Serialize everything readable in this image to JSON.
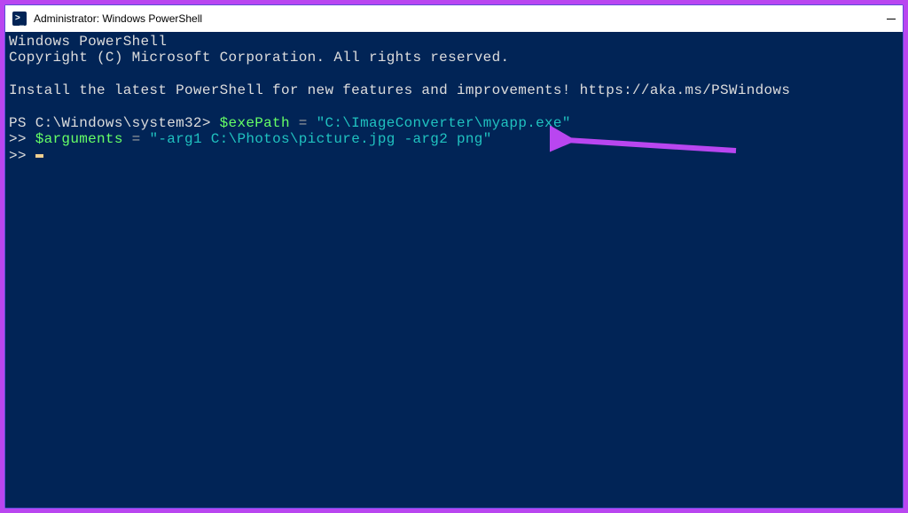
{
  "window": {
    "title": "Administrator: Windows PowerShell"
  },
  "terminal": {
    "header_line1": "Windows PowerShell",
    "header_line2": "Copyright (C) Microsoft Corporation. All rights reserved.",
    "install_line": "Install the latest PowerShell for new features and improvements! https://aka.ms/PSWindows",
    "prompt1_prefix": "PS C:\\Windows\\system32> ",
    "prompt1_var": "$exePath",
    "prompt1_op": " = ",
    "prompt1_str": "\"C:\\ImageConverter\\myapp.exe\"",
    "prompt2_prefix": ">> ",
    "prompt2_var": "$arguments",
    "prompt2_op": " = ",
    "prompt2_str": "\"-arg1 C:\\Photos\\picture.jpg -arg2 png\"",
    "prompt3_prefix": ">> "
  },
  "annotation": {
    "color": "#b946f0"
  }
}
